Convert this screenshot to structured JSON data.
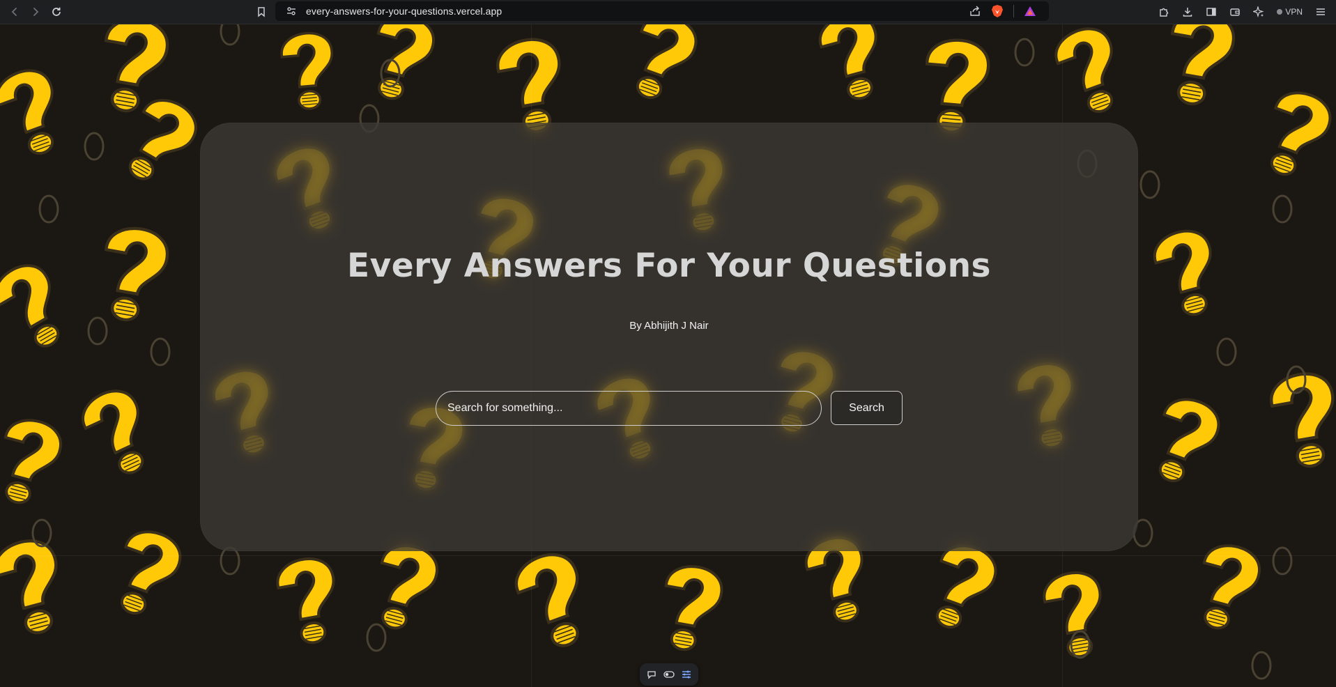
{
  "browser": {
    "url": "every-answers-for-your-questions.vercel.app",
    "vpn_label": "VPN"
  },
  "hero": {
    "title": "Every Answers For Your Questions",
    "subtitle": "By Abhijith J Nair"
  },
  "search": {
    "placeholder": "Search for something...",
    "value": "",
    "button_label": "Search"
  },
  "colors": {
    "accent": "#ffc907",
    "background": "#1b1713",
    "outline": "#3a2f1a"
  },
  "icons": {
    "back": "back-arrow-icon",
    "forward": "forward-arrow-icon",
    "reload": "reload-icon",
    "bookmark": "bookmark-icon",
    "site_info": "site-settings-icon",
    "share": "share-icon",
    "brave_shield": "brave-lion-icon",
    "rewards": "brave-rewards-icon",
    "extensions": "puzzle-piece-icon",
    "downloads": "download-icon",
    "sidebar": "sidebar-icon",
    "wallet": "wallet-icon",
    "leo": "leo-ai-icon",
    "menu": "hamburger-menu-icon",
    "comment": "comment-icon",
    "toggle": "toggle-icon",
    "settings": "sliders-icon"
  }
}
